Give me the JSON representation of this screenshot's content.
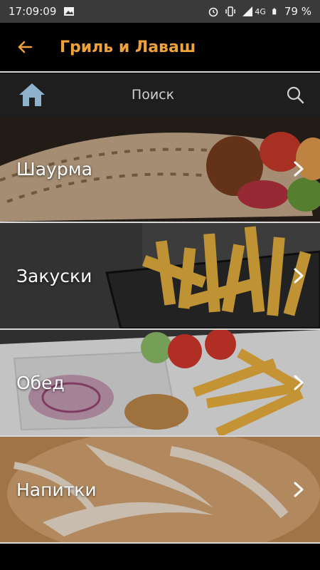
{
  "status_bar": {
    "time": "17:09:09",
    "network": "4G",
    "battery": "79 %",
    "icons": [
      "image-icon",
      "alarm-icon",
      "vibrate-icon",
      "signal-icon",
      "battery-icon"
    ]
  },
  "app_bar": {
    "title": "Гриль и Лаваш",
    "back_icon": "arrow-left-icon"
  },
  "search": {
    "home_icon": "home-icon",
    "label": "Поиск",
    "search_icon": "search-icon"
  },
  "categories": [
    {
      "label": "Шаурма"
    },
    {
      "label": "Закуски"
    },
    {
      "label": "Обед"
    },
    {
      "label": "Напитки"
    }
  ],
  "colors": {
    "accent": "#f0a23a",
    "status_bar": "#3a3a3a",
    "search_bar": "#1e1e1e",
    "home_icon": "#8fb3cc"
  }
}
